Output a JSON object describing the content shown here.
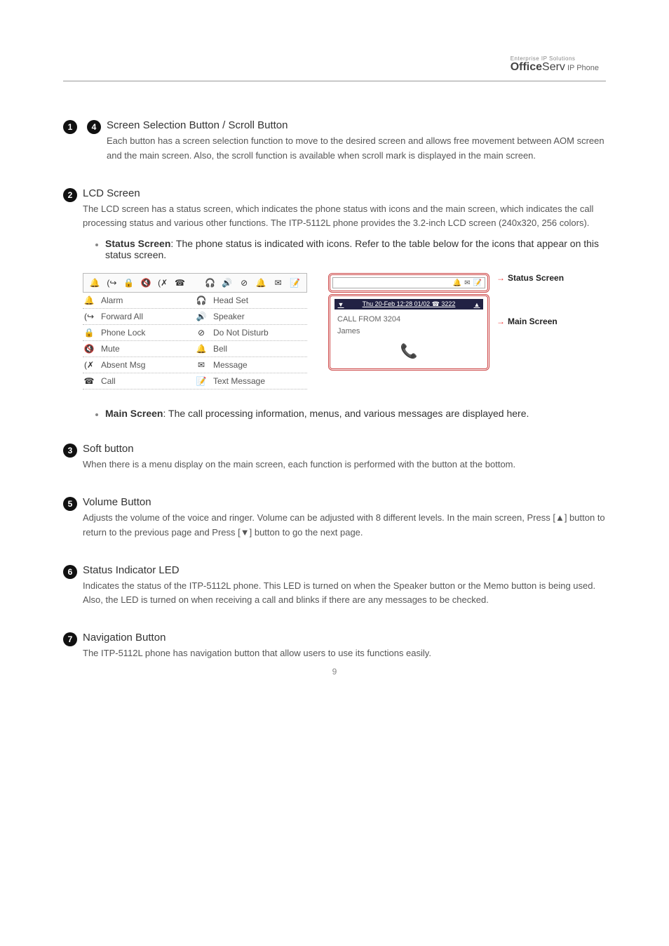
{
  "brand": {
    "small": "Enterprise IP Solutions",
    "main_bold": "Office",
    "main_light": "Serv",
    "ip": "IP Phone"
  },
  "sections": {
    "s1": {
      "nums": [
        "1",
        "4"
      ],
      "title": "Screen Selection Button / Scroll Button",
      "desc": "Each button has a screen selection function to move to the desired screen and allows free movement between AOM screen and the main screen.  Also, the scroll function is available when scroll mark is displayed in the main screen."
    },
    "s2": {
      "num": "2",
      "title": "LCD Screen",
      "desc": "The LCD screen has a status screen, which indicates the phone status with icons and the main screen, which indicates the call processing status and various other functions. The ITP-5112L phone provides the 3.2-inch LCD screen (240x320, 256 colors).",
      "bullet1_label": "Status Screen",
      "bullet1_text": ":  The phone status is indicated with icons.  Refer to the table below for the icons that appear on this status screen.",
      "bullet2_label": "Main Screen",
      "bullet2_text": ":  The call processing information, menus, and various messages are displayed here."
    },
    "icon_table": {
      "rows": [
        {
          "l_icon": "alarm-icon",
          "l": "Alarm",
          "r_icon": "headset-icon",
          "r": "Head Set"
        },
        {
          "l_icon": "forward-icon",
          "l": "Forward All",
          "r_icon": "speaker-icon",
          "r": "Speaker"
        },
        {
          "l_icon": "lock-icon",
          "l": "Phone Lock",
          "r_icon": "dnd-icon",
          "r": "Do Not Disturb"
        },
        {
          "l_icon": "mute-icon",
          "l": "Mute",
          "r_icon": "bell-icon",
          "r": "Bell"
        },
        {
          "l_icon": "absent-icon",
          "l": "Absent Msg",
          "r_icon": "message-icon",
          "r": "Message"
        },
        {
          "l_icon": "call-icon",
          "l": "Call",
          "r_icon": "text-msg-icon",
          "r": "Text Message"
        }
      ]
    },
    "phone": {
      "date": "Thu 20-Feb 12:28 01/02   ☎ 3222",
      "line1": "CALL FROM 3204",
      "line2": "James",
      "callout_status": "Status Screen",
      "callout_main": "Main Screen"
    },
    "s3": {
      "num": "3",
      "title": "Soft button",
      "desc": "When there is a menu display on the main screen, each function is performed with the button at the bottom."
    },
    "s5": {
      "num": "5",
      "title": "Volume Button",
      "desc": "Adjusts the volume of the voice and ringer. Volume can be adjusted with 8 different levels. In the main screen, Press [▲] button to return to the previous page and Press [▼] button to go the next page."
    },
    "s6": {
      "num": "6",
      "title": "Status Indicator LED",
      "desc": "Indicates the status of the ITP-5112L phone. This LED is turned on when the Speaker button or the Memo button is being used.  Also, the LED is turned on when receiving a call and blinks if there are any messages to be checked."
    },
    "s7": {
      "num": "7",
      "title": "Navigation Button",
      "desc": "The ITP-5112L phone has navigation button that allow users to use its functions easily."
    }
  },
  "footer": "9"
}
